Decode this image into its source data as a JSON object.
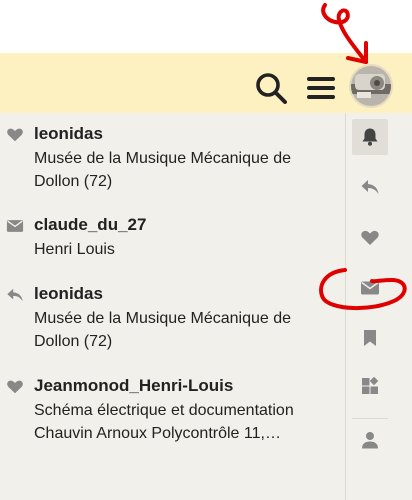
{
  "header": {
    "search_icon": "search-icon",
    "menu_icon": "hamburger-menu-icon",
    "avatar_icon": "user-avatar"
  },
  "notifications": [
    {
      "icon": "heart-icon",
      "user": "leonidas",
      "lines": [
        "Musée de la Musique Mécanique de",
        "Dollon (72)"
      ]
    },
    {
      "icon": "envelope-icon",
      "user": "claude_du_27",
      "lines": [
        "Henri Louis"
      ]
    },
    {
      "icon": "reply-icon",
      "user": "leonidas",
      "lines": [
        "Musée de la Musique Mécanique de",
        "Dollon (72)"
      ]
    },
    {
      "icon": "heart-icon",
      "user": "Jeanmonod_Henri-Louis",
      "lines": [
        "Schéma électrique et documentation",
        "Chauvin Arnoux Polycontrôle 11,…"
      ]
    }
  ],
  "rail": [
    "bell-icon",
    "reply-icon",
    "heart-icon",
    "envelope-icon",
    "bookmark-icon",
    "widgets-icon",
    "user-icon"
  ],
  "colors": {
    "header_bg": "#fdf0c1",
    "panel_bg": "#f2f0eb",
    "icon": "#888888",
    "annotation": "#e00000"
  }
}
